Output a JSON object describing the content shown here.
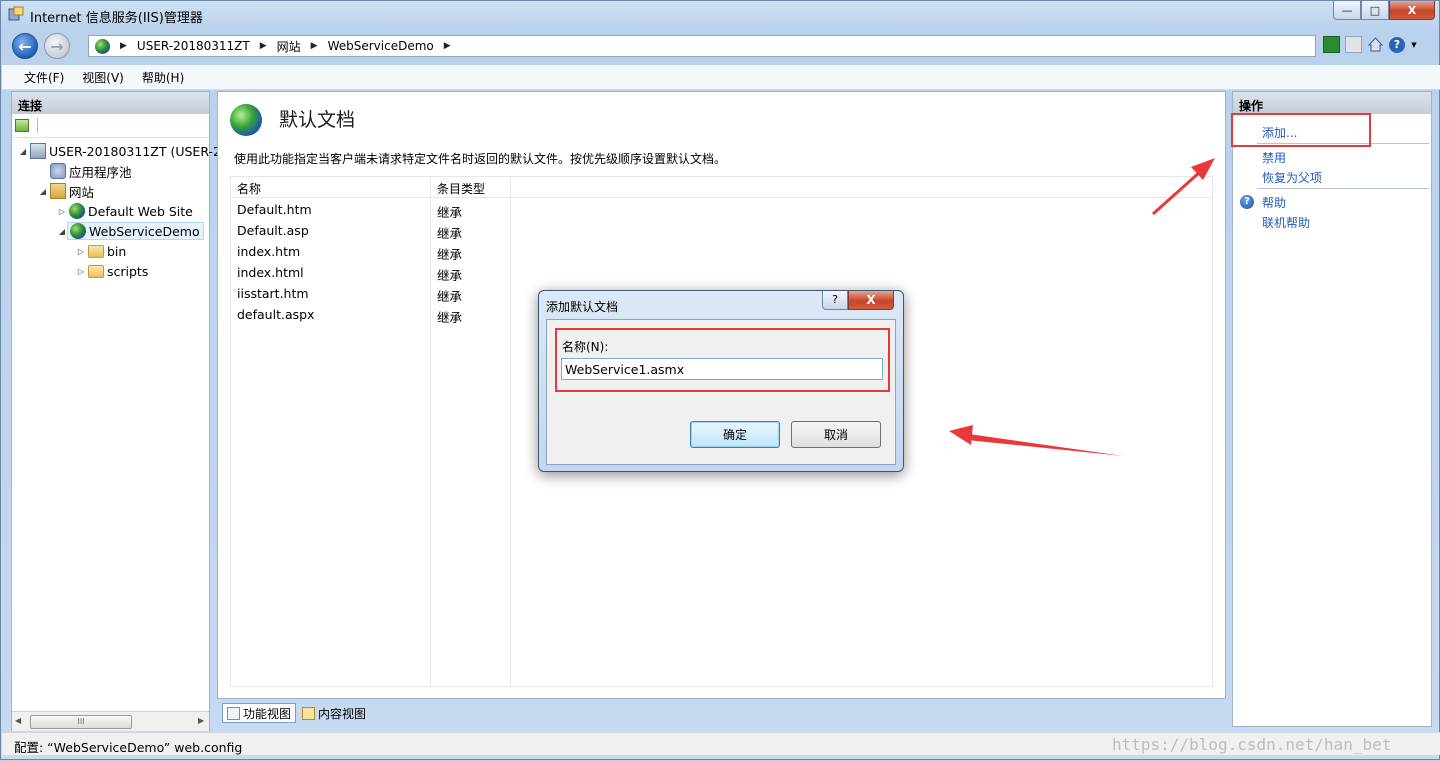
{
  "window": {
    "title": "Internet 信息服务(IIS)管理器",
    "controls": {
      "minimize": "—",
      "maximize": "□",
      "close": "X"
    }
  },
  "address": {
    "back": "←",
    "forward": "→",
    "crumbs": [
      "USER-20180311ZT",
      "网站",
      "WebServiceDemo"
    ],
    "arrow": "▶"
  },
  "menu": [
    "文件(F)",
    "视图(V)",
    "帮助(H)"
  ],
  "left_panel": {
    "header": "连接",
    "tree": [
      {
        "label": "USER-20180311ZT (USER-2",
        "expander": "◢"
      },
      {
        "label": "应用程序池",
        "expander": ""
      },
      {
        "label": "网站",
        "expander": "◢"
      },
      {
        "label": "Default Web Site",
        "expander": "▷"
      },
      {
        "label": "WebServiceDemo",
        "expander": "◢"
      },
      {
        "label": "bin",
        "expander": "▷"
      },
      {
        "label": "scripts",
        "expander": "▷"
      }
    ],
    "scroll_grip": "III"
  },
  "center": {
    "title": "默认文档",
    "description": "使用此功能指定当客户端未请求特定文件名时返回的默认文件。按优先级顺序设置默认文档。",
    "columns": [
      "名称",
      "条目类型"
    ],
    "rows": [
      {
        "name": "Default.htm",
        "type": "继承"
      },
      {
        "name": "Default.asp",
        "type": "继承"
      },
      {
        "name": "index.htm",
        "type": "继承"
      },
      {
        "name": "index.html",
        "type": "继承"
      },
      {
        "name": "iisstart.htm",
        "type": "继承"
      },
      {
        "name": "default.aspx",
        "type": "继承"
      }
    ],
    "tabs": [
      "功能视图",
      "内容视图"
    ]
  },
  "right_panel": {
    "header": "操作",
    "actions": [
      "添加...",
      "禁用",
      "恢复为父项"
    ],
    "help_icon_glyph": "?",
    "help": [
      "帮助",
      "联机帮助"
    ]
  },
  "dialog": {
    "title": "添加默认文档",
    "help_btn": "?",
    "close_btn": "X",
    "name_label": "名称(N):",
    "name_value": "WebService1.asmx",
    "ok": "确定",
    "cancel": "取消"
  },
  "status": {
    "text": "配置: “WebServiceDemo” web.config",
    "watermark": "https://blog.csdn.net/han_bet"
  },
  "colors": {
    "highlight": "#e8393a",
    "link": "#1f5bbd"
  }
}
